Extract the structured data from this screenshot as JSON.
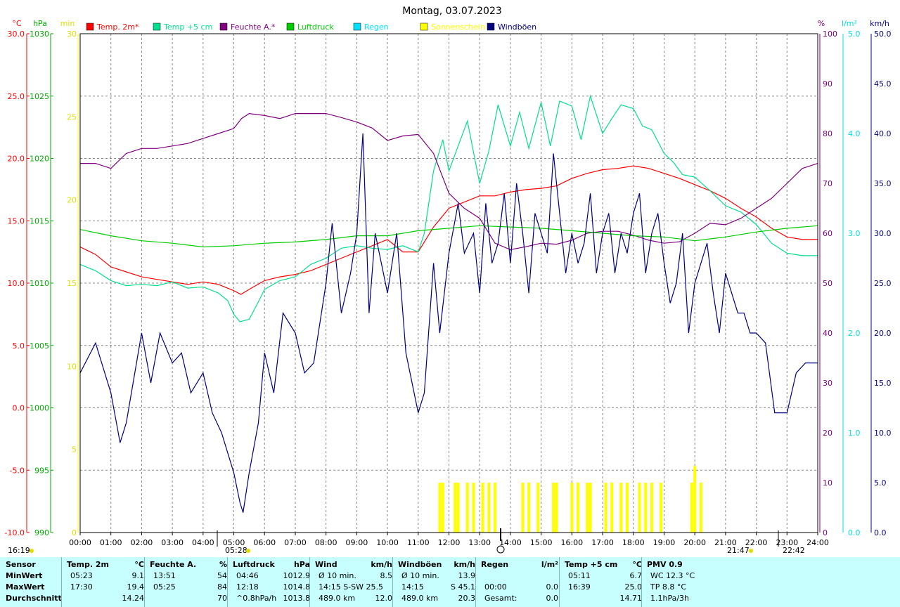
{
  "chart_data": {
    "type": "line",
    "title": "Montag, 03.07.2023",
    "legend": [
      {
        "name": "Temp. 2m*",
        "color": "#ff0000"
      },
      {
        "name": "Temp +5 cm",
        "color": "#00e08c"
      },
      {
        "name": "Feuchte A.*",
        "color": "#800080"
      },
      {
        "name": "Luftdruck",
        "color": "#00cc00"
      },
      {
        "name": "Regen",
        "color": "#00e0ff"
      },
      {
        "name": "Sonnenschein",
        "color": "#ffff00"
      },
      {
        "name": "Windböen",
        "color": "#000080"
      }
    ],
    "axes": {
      "temp": {
        "unit": "°C",
        "min": -10,
        "max": 30,
        "ticks": [
          "30.0",
          "25.0",
          "20.0",
          "15.0",
          "10.0",
          "5.0",
          "0.0",
          "-5.0",
          "-10.0"
        ],
        "color": "#ff0000"
      },
      "pressure": {
        "unit": "hPa",
        "min": 990,
        "max": 1030,
        "ticks": [
          "1030",
          "1025",
          "1020",
          "1015",
          "1010",
          "1005",
          "1000",
          "995",
          "990"
        ],
        "color": "#00aa00"
      },
      "sun": {
        "unit": "min",
        "min": 0,
        "max": 30,
        "ticks": [
          "30",
          "25",
          "20",
          "15",
          "10",
          "5",
          "0"
        ],
        "color": "#e0e000"
      },
      "humidity": {
        "unit": "%",
        "min": 0,
        "max": 100,
        "ticks": [
          "100",
          "90",
          "80",
          "70",
          "60",
          "50",
          "40",
          "30",
          "20",
          "10",
          "0"
        ],
        "color": "#800080"
      },
      "rain": {
        "unit": "l/m²",
        "min": 0,
        "max": 5,
        "ticks": [
          "5.0",
          "4.0",
          "3.0",
          "2.0",
          "1.0",
          "0.0"
        ],
        "color": "#00e0e0"
      },
      "wind": {
        "unit": "km/h",
        "min": 0,
        "max": 50,
        "ticks": [
          "50.0",
          "45.0",
          "40.0",
          "35.0",
          "30.0",
          "25.0",
          "20.0",
          "15.0",
          "10.0",
          "5.0",
          "0.0"
        ],
        "color": "#000080"
      }
    },
    "x_ticks": [
      "00:00",
      "01:00",
      "02:00",
      "03:00",
      "04:00",
      "05:00",
      "06:00",
      "07:00",
      "08:00",
      "09:00",
      "10:00",
      "11:00",
      "12:00",
      "13:00",
      "14:00",
      "15:00",
      "16:00",
      "17:00",
      "18:00",
      "19:00",
      "20:00",
      "21:00",
      "22:00",
      "23:00",
      "24:00"
    ],
    "x_annotations": [
      "16:19",
      "05:28",
      "21:47",
      "22:42"
    ],
    "series": [
      {
        "name": "Temp. 2m*",
        "axis": "temp",
        "x": [
          0,
          0.5,
          1,
          1.5,
          2,
          2.5,
          3,
          3.5,
          4,
          4.5,
          5,
          5.23,
          5.5,
          6,
          6.5,
          7,
          7.5,
          8,
          8.5,
          9,
          9.5,
          10,
          10.5,
          11,
          11.5,
          12,
          12.5,
          13,
          13.5,
          14,
          14.5,
          15,
          15.5,
          16,
          16.5,
          17,
          17.5,
          18,
          18.5,
          19,
          19.5,
          20,
          20.5,
          21,
          21.5,
          22,
          22.5,
          23,
          23.5,
          24
        ],
        "values": [
          12.9,
          12.3,
          11.3,
          10.9,
          10.5,
          10.3,
          10.1,
          9.9,
          10.1,
          9.9,
          9.4,
          9.1,
          9.5,
          10.2,
          10.5,
          10.7,
          11,
          11.5,
          12,
          12.5,
          13,
          13.5,
          12.5,
          12.5,
          14.5,
          16,
          16.5,
          17,
          17,
          17.3,
          17.5,
          17.6,
          17.8,
          18.4,
          18.8,
          19.1,
          19.2,
          19.4,
          19.2,
          18.8,
          18.4,
          17.9,
          17.4,
          16.8,
          16,
          15.3,
          14.4,
          13.7,
          13.5,
          13.5
        ]
      },
      {
        "name": "Temp +5 cm",
        "axis": "temp",
        "x": [
          0,
          0.5,
          1,
          1.5,
          2,
          2.5,
          3,
          3.5,
          4,
          4.5,
          4.8,
          5,
          5.2,
          5.5,
          5.8,
          6,
          6.5,
          7,
          7.5,
          8,
          8.5,
          9,
          9.5,
          10,
          10.5,
          11,
          11.2,
          11.5,
          11.8,
          12,
          12.3,
          12.6,
          13,
          13.3,
          13.6,
          14,
          14.3,
          14.6,
          15,
          15.3,
          15.6,
          16,
          16.3,
          16.6,
          17,
          17.3,
          17.6,
          18,
          18.3,
          18.6,
          19,
          19.3,
          19.6,
          20,
          20.5,
          21,
          21.5,
          22,
          22.5,
          23,
          23.5,
          24
        ],
        "values": [
          11.5,
          11,
          10.2,
          9.8,
          9.9,
          9.8,
          10.1,
          9.6,
          9.7,
          9.2,
          8.6,
          7.5,
          6.9,
          7.1,
          8.5,
          9.5,
          10.2,
          10.5,
          11.5,
          12,
          12.8,
          13,
          12.8,
          12.7,
          13,
          12.5,
          14,
          19,
          21.5,
          19,
          21,
          23,
          18,
          20.6,
          24.3,
          21,
          23.7,
          20.8,
          24.5,
          21,
          24.6,
          24.2,
          21.5,
          25,
          22,
          23.2,
          24.3,
          24,
          22.6,
          22.3,
          20.4,
          19.7,
          18.7,
          18.5,
          17.4,
          16.2,
          15.7,
          14.7,
          13.2,
          12.4,
          12.2,
          12.2
        ]
      },
      {
        "name": "Feuchte A.*",
        "axis": "humidity",
        "x": [
          0,
          0.5,
          1,
          1.5,
          2,
          2.5,
          3,
          3.5,
          4,
          4.5,
          5,
          5.25,
          5.5,
          6,
          6.5,
          7,
          7.5,
          8,
          8.5,
          9,
          9.5,
          10,
          10.5,
          11,
          11.5,
          12,
          12.5,
          13,
          13.5,
          14,
          14.5,
          15,
          15.5,
          16,
          16.5,
          17,
          17.5,
          18,
          18.5,
          19,
          19.5,
          20,
          20.5,
          21,
          21.5,
          22,
          22.5,
          23,
          23.5,
          24
        ],
        "values": [
          74,
          74,
          73,
          76,
          77,
          77,
          77.5,
          78,
          79,
          80,
          81,
          83,
          84,
          83.6,
          83,
          84,
          84,
          84,
          83.2,
          82.3,
          81.1,
          78.6,
          79.5,
          79.8,
          76,
          68,
          65,
          63,
          58,
          56.7,
          57.3,
          58,
          57.8,
          58.6,
          60,
          60.4,
          60.4,
          59.6,
          58.6,
          58,
          58.3,
          60,
          62,
          61.7,
          63,
          65,
          67,
          70,
          73,
          74
        ]
      },
      {
        "name": "Luftdruck",
        "axis": "pressure",
        "x": [
          0,
          1,
          2,
          3,
          4,
          5,
          6,
          7,
          8,
          9,
          10,
          11,
          12,
          13,
          14,
          15,
          16,
          17,
          18,
          19,
          20,
          21,
          22,
          23,
          24
        ],
        "values": [
          1014.3,
          1013.8,
          1013.4,
          1013.2,
          1012.9,
          1013.0,
          1013.2,
          1013.3,
          1013.5,
          1013.8,
          1013.8,
          1014.2,
          1014.4,
          1014.6,
          1014.5,
          1014.4,
          1014.2,
          1014.0,
          1013.8,
          1013.7,
          1013.4,
          1013.7,
          1014.1,
          1014.4,
          1014.6
        ]
      },
      {
        "name": "Windböen",
        "axis": "wind",
        "x": [
          0,
          0.5,
          1,
          1.3,
          1.5,
          2,
          2.3,
          2.6,
          3,
          3.3,
          3.6,
          4,
          4.3,
          4.6,
          5,
          5.2,
          5.3,
          5.5,
          5.8,
          6,
          6.3,
          6.6,
          7,
          7.3,
          7.6,
          8,
          8.2,
          8.5,
          8.8,
          9,
          9.2,
          9.4,
          9.6,
          10,
          10.3,
          10.6,
          11,
          11.2,
          11.5,
          11.7,
          12,
          12.3,
          12.5,
          12.8,
          13,
          13.2,
          13.4,
          13.6,
          13.8,
          14,
          14.2,
          14.4,
          14.6,
          14.8,
          15,
          15.2,
          15.4,
          15.6,
          15.8,
          16,
          16.2,
          16.4,
          16.6,
          16.8,
          17,
          17.2,
          17.4,
          17.6,
          17.8,
          18,
          18.2,
          18.4,
          18.6,
          18.8,
          19,
          19.2,
          19.4,
          19.6,
          19.8,
          20,
          20.2,
          20.4,
          20.6,
          20.8,
          21,
          21.2,
          21.4,
          21.6,
          21.8,
          22,
          22.3,
          22.6,
          23,
          23.3,
          23.6,
          24
        ],
        "values": [
          16,
          19,
          14,
          9,
          11,
          20,
          15,
          20,
          17,
          18,
          14,
          16,
          12,
          10,
          6,
          3,
          2,
          6,
          11,
          18,
          14,
          22,
          20,
          16,
          17,
          25,
          31,
          22,
          26,
          30,
          40,
          22,
          30,
          24,
          30,
          18,
          12,
          14,
          27,
          20,
          28,
          33,
          28,
          30,
          24,
          33,
          27,
          29,
          34,
          27,
          35,
          30,
          24,
          32,
          30,
          28,
          38,
          32,
          26,
          30,
          27,
          29,
          34,
          26,
          30,
          32,
          26,
          30,
          28,
          32,
          34,
          26,
          30,
          32,
          27,
          23,
          25,
          30,
          20,
          25,
          27,
          29,
          24,
          20,
          26,
          24,
          22,
          22,
          20,
          20,
          19,
          12,
          12,
          16,
          17,
          17
        ]
      }
    ],
    "sunshine_bars": {
      "axis": "sun",
      "x": [
        11.7,
        11.8,
        12.2,
        12.3,
        12.6,
        12.8,
        13.1,
        13.3,
        13.5,
        14.4,
        14.6,
        14.9,
        15.4,
        15.5,
        16.0,
        16.2,
        16.5,
        16.6,
        17.1,
        17.3,
        17.6,
        17.8,
        18.2,
        18.4,
        18.6,
        18.9,
        19.9,
        20.0,
        20.2
      ],
      "values": [
        3,
        3,
        3,
        3,
        3,
        3,
        3,
        3,
        3,
        3,
        3,
        3,
        3,
        3,
        3,
        3,
        3,
        3,
        3,
        3,
        3,
        3,
        3,
        3,
        3,
        3,
        3,
        4,
        3
      ]
    }
  },
  "stats": {
    "columns": [
      {
        "header": "Sensor",
        "unit": "",
        "rows": [
          {
            "label": "MinWert",
            "value": ""
          },
          {
            "label": "MaxWert",
            "value": ""
          },
          {
            "label": "Durchschnitt",
            "value": ""
          }
        ]
      },
      {
        "header": "Temp. 2m",
        "unit": "°C",
        "rows": [
          {
            "label": "05:23",
            "value": "9.1"
          },
          {
            "label": "17:30",
            "value": "19.4"
          },
          {
            "label": "",
            "value": "14.24"
          }
        ]
      },
      {
        "header": "Feuchte A.",
        "unit": "%",
        "rows": [
          {
            "label": "13:51",
            "value": "54"
          },
          {
            "label": "05:25",
            "value": "84"
          },
          {
            "label": "",
            "value": "70"
          }
        ]
      },
      {
        "header": "Luftdruck",
        "unit": "hPa",
        "rows": [
          {
            "label": "04:46",
            "value": "1012.9"
          },
          {
            "label": "12:18",
            "value": "1014.8"
          },
          {
            "label": "^0.8hPa/h",
            "value": "1013.8"
          }
        ]
      },
      {
        "header": "Wind",
        "unit": "km/h",
        "rows": [
          {
            "label": "Ø 10 min.",
            "value": "8.5"
          },
          {
            "label": "14:15    S-SW 25.5",
            "value": ""
          },
          {
            "label": "489.0 km",
            "value": "12.0"
          }
        ]
      },
      {
        "header": "Windböen",
        "unit": "km/h",
        "rows": [
          {
            "label": "Ø 10 min.",
            "value": "13.9"
          },
          {
            "label": "14:15",
            "value": "S 45.1"
          },
          {
            "label": "489.0 km",
            "value": "20.3"
          }
        ]
      },
      {
        "header": "Regen",
        "unit": "l/m²",
        "rows": [
          {
            "label": "",
            "value": ""
          },
          {
            "label": "00:00",
            "value": "0.0"
          },
          {
            "label": "Gesamt:",
            "value": "0.0"
          }
        ]
      },
      {
        "header": "Temp +5 cm",
        "unit": "°C",
        "rows": [
          {
            "label": "05:11",
            "value": "6.7"
          },
          {
            "label": "16:39",
            "value": "25.0"
          },
          {
            "label": "",
            "value": "14.71"
          }
        ]
      },
      {
        "header": "PMV 0.9",
        "unit": "",
        "rows": [
          {
            "label": "WC 12.3 °C",
            "value": ""
          },
          {
            "label": "TP 8.8 °C",
            "value": ""
          },
          {
            "label": "1.1hPa/3h",
            "value": ""
          }
        ]
      }
    ]
  }
}
